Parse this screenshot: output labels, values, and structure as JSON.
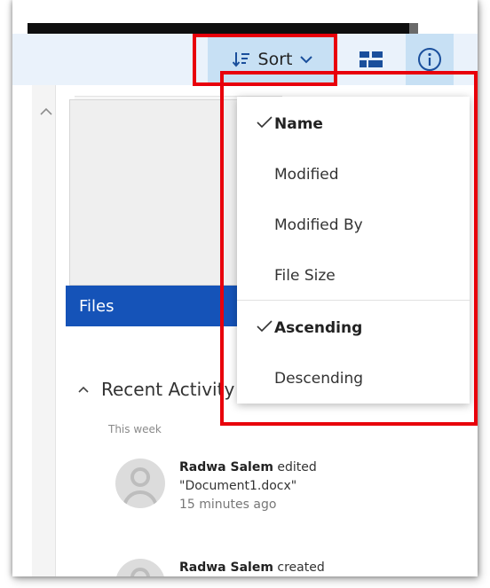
{
  "toolbar": {
    "sort_label": "Sort",
    "sort_icon": "sort-descending-icon",
    "tiles_icon": "tiles-view-icon",
    "info_icon": "info-icon"
  },
  "sort_menu": {
    "sort_by": [
      {
        "label": "Name",
        "checked": true
      },
      {
        "label": "Modified",
        "checked": false
      },
      {
        "label": "Modified By",
        "checked": false
      },
      {
        "label": "File Size",
        "checked": false
      }
    ],
    "order": [
      {
        "label": "Ascending",
        "checked": true
      },
      {
        "label": "Descending",
        "checked": false
      }
    ]
  },
  "files_tile": {
    "label": "Files"
  },
  "recent": {
    "title": "Recent Activity",
    "group_label": "This week",
    "items": [
      {
        "user": "Radwa Salem",
        "action": "edited",
        "target": "\"Document1.docx\"",
        "time": "15 minutes ago"
      },
      {
        "user": "Radwa Salem",
        "action": "created",
        "target": "",
        "time": ""
      }
    ]
  },
  "colors": {
    "accent": "#1553b8",
    "command_bar_bg": "#eaf2fb",
    "selected_button_bg": "#c7e0f4",
    "highlight_box": "#e8000b"
  }
}
